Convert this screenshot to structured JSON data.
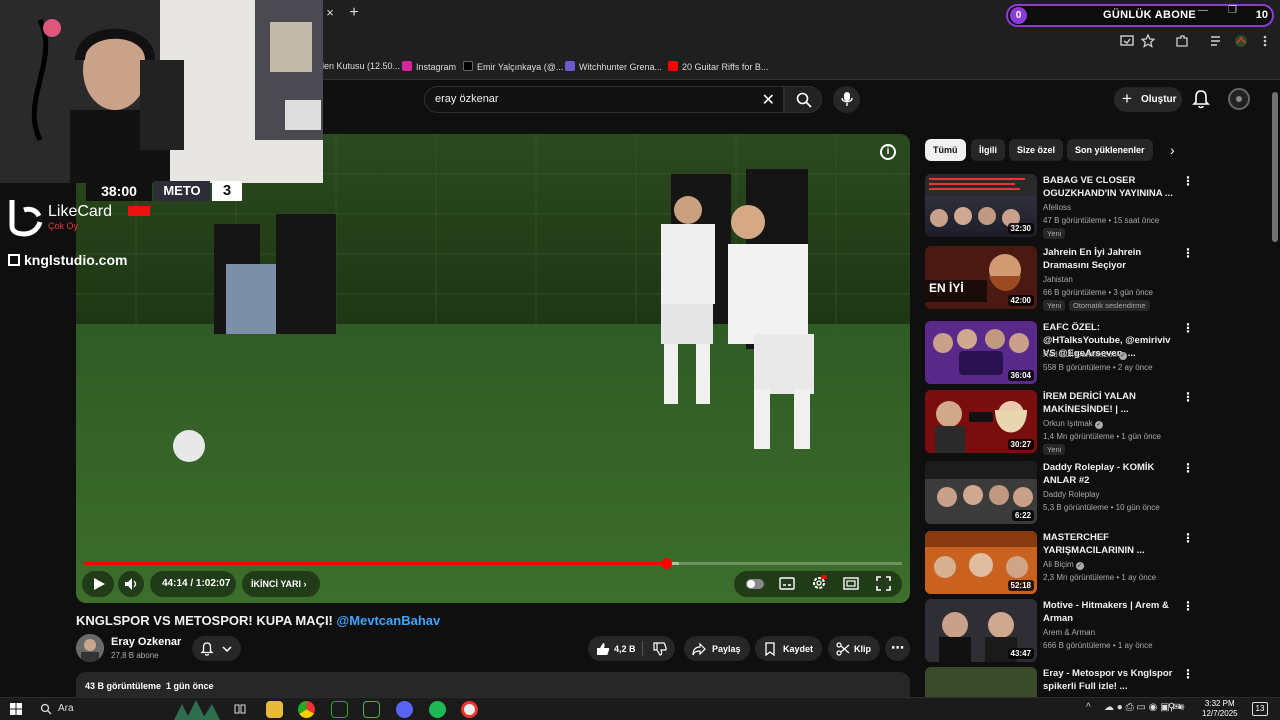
{
  "browser": {
    "tab_close": "×",
    "tab_new": "+",
    "widget": {
      "left_count": "0",
      "label": "GÜNLÜK ABONE",
      "right_count": "10"
    },
    "bookmarks": [
      {
        "label": "len Kutusu (12.50...",
        "color": "#888888"
      },
      {
        "label": "Instagram",
        "color": "#d6249f"
      },
      {
        "label": "Emir Yalçınkaya (@...",
        "color": "#000000"
      },
      {
        "label": "Witchhunter Grena...",
        "color": "#6a5acd"
      },
      {
        "label": "20 Guitar Riffs for B...",
        "color": "#ff0000"
      }
    ]
  },
  "header": {
    "search_value": "eray özkenar",
    "create_label": "Oluştur"
  },
  "player": {
    "time": "44:14 / 1:02:07",
    "chapter": "İKİNCİ YARI",
    "progress_fraction": 0.712,
    "buffer_fraction": 0.728,
    "info_glyph": "i"
  },
  "overlay": {
    "score_time": "38:00",
    "score_team": "METO",
    "score_value": "3",
    "likecard_title": "LikeCard",
    "likecard_sub": "Çok Oy",
    "studio": "knglstudio.com"
  },
  "video": {
    "title": "KNGLSPOR VS METOSPOR! KUPA MAÇI!",
    "mention": "@MevtcanBahav",
    "channel": "Eray Ozkenar",
    "subs": "27,8 B abone",
    "likes": "4,2 B",
    "share": "Paylaş",
    "save": "Kaydet",
    "clip": "Klip",
    "views": "43 B görüntüleme",
    "ago": "1 gün önce"
  },
  "chips": [
    "Tümü",
    "İlgili",
    "Size özel",
    "Son yüklenenler"
  ],
  "recommendations": [
    {
      "title": "BABAG VE CLOSER OGUZKHAND'IN YAYININA ...",
      "channel": "Afelioss",
      "meta": "47 B görüntüleme • 15 saat önce",
      "duration": "32:30",
      "badge": "Yeni",
      "verified": false
    },
    {
      "title": "Jahrein En İyi Jahrein Dramasını Seçiyor",
      "channel": "Jahistan",
      "meta": "66 B görüntüleme • 3 gün önce",
      "duration": "42:00",
      "badge": "Yeni",
      "badge2": "Otomatik seslendirme",
      "verified": false
    },
    {
      "title": "EAFC ÖZEL: @HTalksYoutube, @emiriviv VS @EgeArseven, ...",
      "channel": "Red Bull Gamerszon",
      "meta": "558 B görüntüleme • 2 ay önce",
      "duration": "36:04",
      "verified": true
    },
    {
      "title": "İREM DERİCİ YALAN MAKİNESİNDE! | ...",
      "channel": "Orkun Işıtmak",
      "meta": "1,4 Mn görüntüleme • 1 gün önce",
      "duration": "30:27",
      "badge": "Yeni",
      "verified": true
    },
    {
      "title": "Daddy Roleplay - KOMİK ANLAR #2",
      "channel": "Daddy Roleplay",
      "meta": "5,3 B görüntüleme • 10 gün önce",
      "duration": "6:22",
      "verified": false
    },
    {
      "title": "MASTERCHEF YARIŞMACILARININ ...",
      "channel": "Ali Biçim",
      "meta": "2,3 Mn görüntüleme • 1 ay önce",
      "duration": "52:18",
      "verified": true
    },
    {
      "title": "Motive - Hitmakers | Arem & Arman",
      "channel": "Arem & Arman",
      "meta": "666 B görüntüleme • 1 ay önce",
      "duration": "43:47",
      "verified": false
    },
    {
      "title": "Eray - Metospor vs Knglspor spikerli Full izle! ...",
      "channel": "",
      "meta": "",
      "duration": "",
      "verified": false
    }
  ],
  "taskbar": {
    "search": "Ara",
    "time": "3:32 PM",
    "date": "12/7/2025",
    "notif": "13"
  }
}
